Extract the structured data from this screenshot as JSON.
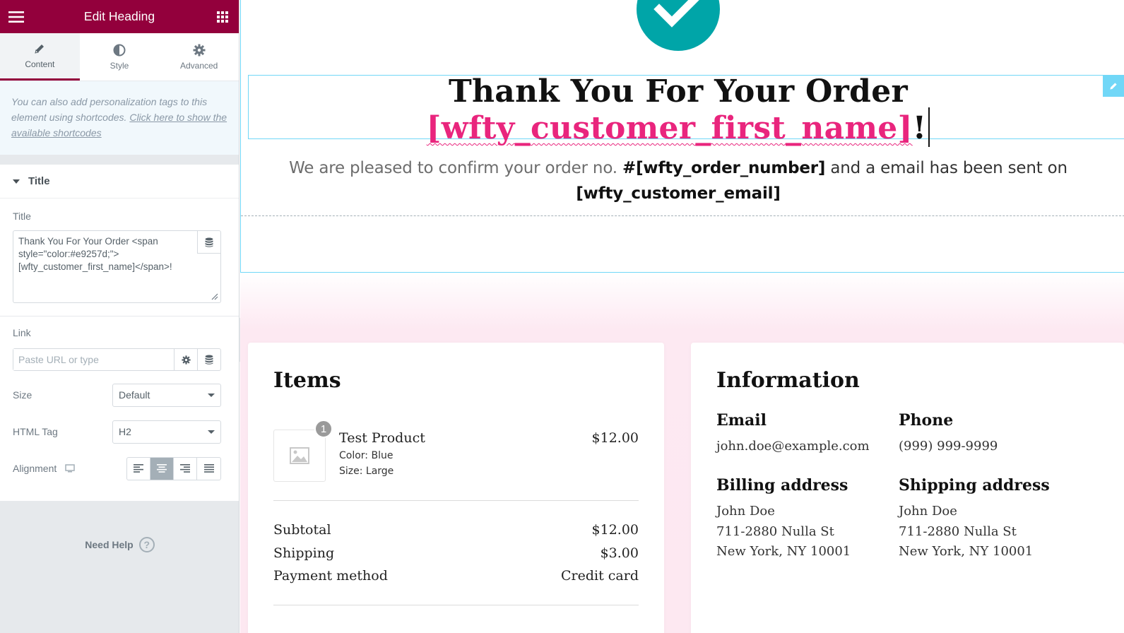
{
  "editor": {
    "title": "Edit Heading",
    "tabs": [
      {
        "label": "Content",
        "icon": "pencil-icon"
      },
      {
        "label": "Style",
        "icon": "half-circle-icon"
      },
      {
        "label": "Advanced",
        "icon": "gear-icon"
      }
    ],
    "note": {
      "text": "You can also add personalization tags to this element using shortcodes. ",
      "link": "Click here to show the available shortcodes"
    },
    "section_title": "Title",
    "title_label": "Title",
    "title_value": "Thank You For Your Order <span style=\"color:#e9257d;\">[wfty_customer_first_name]</span>!",
    "link_label": "Link",
    "link_placeholder": "Paste URL or type",
    "size_label": "Size",
    "size_value": "Default",
    "html_tag_label": "HTML Tag",
    "html_tag_value": "H2",
    "alignment_label": "Alignment",
    "alignment_selected": "center",
    "help_label": "Need Help",
    "help_glyph": "?"
  },
  "preview": {
    "heading_main": "Thank You For Your Order",
    "heading_name": "[wfty_customer_first_name]",
    "heading_end": "!",
    "sub_prefix": "We are pleased to confirm your order no. ",
    "sub_order": "#[wfty_order_number]",
    "sub_mid": " and a email has been sent on",
    "sub_email": "[wfty_customer_email]",
    "items": {
      "title": "Items",
      "qty": "1",
      "product_name": "Test Product",
      "color": "Color: Blue",
      "size": "Size: Large",
      "price": "$12.00",
      "subtotal_label": "Subtotal",
      "subtotal_value": "$12.00",
      "shipping_label": "Shipping",
      "shipping_value": "$3.00",
      "payment_label": "Payment method",
      "payment_value": "Credit card"
    },
    "info": {
      "title": "Information",
      "email_label": "Email",
      "email_value": "john.doe@example.com",
      "phone_label": "Phone",
      "phone_value": "(999) 999-9999",
      "billing_label": "Billing address",
      "billing_lines": [
        "John Doe",
        "711-2880 Nulla St",
        "New York, NY 10001"
      ],
      "shipping_label": "Shipping address",
      "shipping_lines": [
        "John Doe",
        "711-2880 Nulla St",
        "New York, NY 10001"
      ]
    }
  },
  "colors": {
    "brand": "#93003c",
    "accent_pink": "#e9257d",
    "check_teal": "#00a5a8",
    "selection_blue": "#71d7f7"
  }
}
